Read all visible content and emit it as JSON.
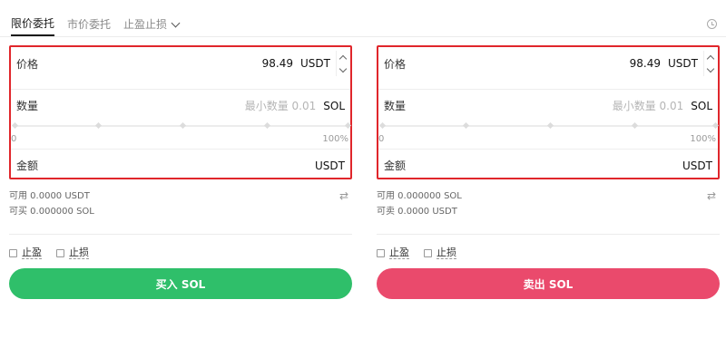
{
  "tabs": [
    {
      "label": "限价委托",
      "active": true
    },
    {
      "label": "市价委托",
      "active": false
    },
    {
      "label": "止盈止损",
      "active": false
    }
  ],
  "buy": {
    "price_label": "价格",
    "price_value": "98.49",
    "price_unit": "USDT",
    "qty_label": "数量",
    "qty_placeholder": "最小数量 0.01",
    "qty_unit": "SOL",
    "slider_min": "0",
    "slider_max": "100%",
    "amount_label": "金额",
    "amount_unit": "USDT",
    "available": "可用 0.0000 USDT",
    "can_trade": "可买 0.000000 SOL",
    "take_profit": "止盈",
    "stop_loss": "止损",
    "button_label": "买入 SOL"
  },
  "sell": {
    "price_label": "价格",
    "price_value": "98.49",
    "price_unit": "USDT",
    "qty_label": "数量",
    "qty_placeholder": "最小数量 0.01",
    "qty_unit": "SOL",
    "slider_min": "0",
    "slider_max": "100%",
    "amount_label": "金额",
    "amount_unit": "USDT",
    "available": "可用 0.000000 SOL",
    "can_trade": "可卖 0.0000 USDT",
    "take_profit": "止盈",
    "stop_loss": "止损",
    "button_label": "卖出 SOL"
  },
  "icons": {
    "history": "clock-icon",
    "swap": "swap-arrows-icon",
    "stepper": "chevron-up-down-icon"
  },
  "colors": {
    "buy": "#2fbf6a",
    "sell": "#ea4a6c",
    "highlight": "#e0262b"
  }
}
